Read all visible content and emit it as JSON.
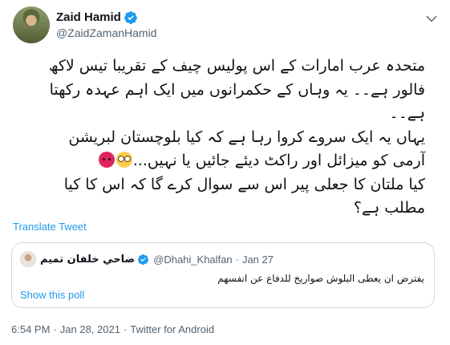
{
  "author": {
    "display_name": "Zaid Hamid",
    "handle": "@ZaidZamanHamid",
    "verified": true
  },
  "tweet": {
    "lines": [
      "متحدہ عرب امارات کے اس پولیس چیف کے تقریبا تیس لاکھ",
      "فالور ہے۔۔ یہ وہاں کے حکمرانوں میں ایک اہم عہدہ رکھتا",
      "ہے۔۔",
      "یہاں یہ ایک سروے کروا رہا ہے کہ کیا بلوچستان لبریشن",
      "آرمی کو میزائل اور راکٹ دیئے جائیں یا نہیں...",
      "کیا ملتان کا جعلی پیر اس سے سوال کرے گا کہ اس کا کیا",
      "مطلب ہے؟"
    ],
    "emojis": [
      "angry-face",
      "flushed-face"
    ],
    "translate_label": "Translate Tweet"
  },
  "quote": {
    "display_name": "ضاحي خلفان تميم",
    "handle": "@Dhahi_Khalfan",
    "separator": "·",
    "date": "Jan 27",
    "text": "يفترض ان يعطى البلوش صواريخ للدفاع عن انفسهم",
    "poll_label": "Show this poll"
  },
  "meta": {
    "time": "6:54 PM",
    "separator": "·",
    "date": "Jan 28, 2021",
    "source": "Twitter for Android"
  },
  "colors": {
    "accent": "#1d9bf0",
    "text": "#0f1419",
    "secondary": "#536471",
    "border": "#cfd9de"
  }
}
